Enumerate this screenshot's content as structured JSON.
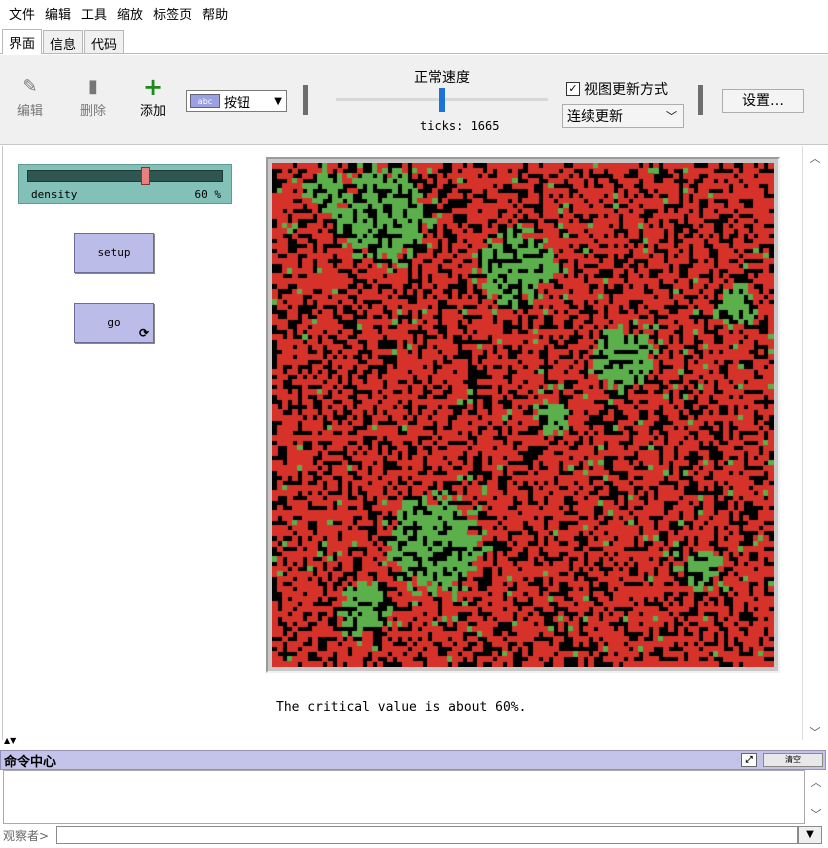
{
  "menu": [
    "文件",
    "编辑",
    "工具",
    "缩放",
    "标签页",
    "帮助"
  ],
  "tabs": [
    {
      "label": "界面",
      "active": true
    },
    {
      "label": "信息",
      "active": false
    },
    {
      "label": "代码",
      "active": false
    }
  ],
  "toolbar": {
    "edit_label": "编辑",
    "delete_label": "删除",
    "add_label": "添加",
    "widget_type": "按钮",
    "speed_label": "正常速度",
    "speed_value": 0.5,
    "ticks_text": "ticks: 1665",
    "view_update_label": "视图更新方式",
    "view_update_checked": true,
    "update_mode": "连续更新",
    "settings_label": "设置…",
    "icons": {
      "edit": "pencil-icon",
      "delete": "trash-icon",
      "add": "plus-icon"
    }
  },
  "widgets": {
    "slider": {
      "label": "density",
      "value_text": "60 %",
      "value": 60,
      "min": 0,
      "max": 100
    },
    "setup_button": "setup",
    "go_button": "go",
    "go_forever_icon": "forever-icon"
  },
  "world": {
    "size": 100,
    "density": 0.6,
    "colors": {
      "unburnt": "#5bb04b",
      "burnt": "#d7322a",
      "empty": "#000000"
    }
  },
  "note": "The critical value is about 60%.",
  "command_center": {
    "title": "命令中心",
    "clear_label": "清空",
    "prompt": "观察者>",
    "input_value": ""
  }
}
